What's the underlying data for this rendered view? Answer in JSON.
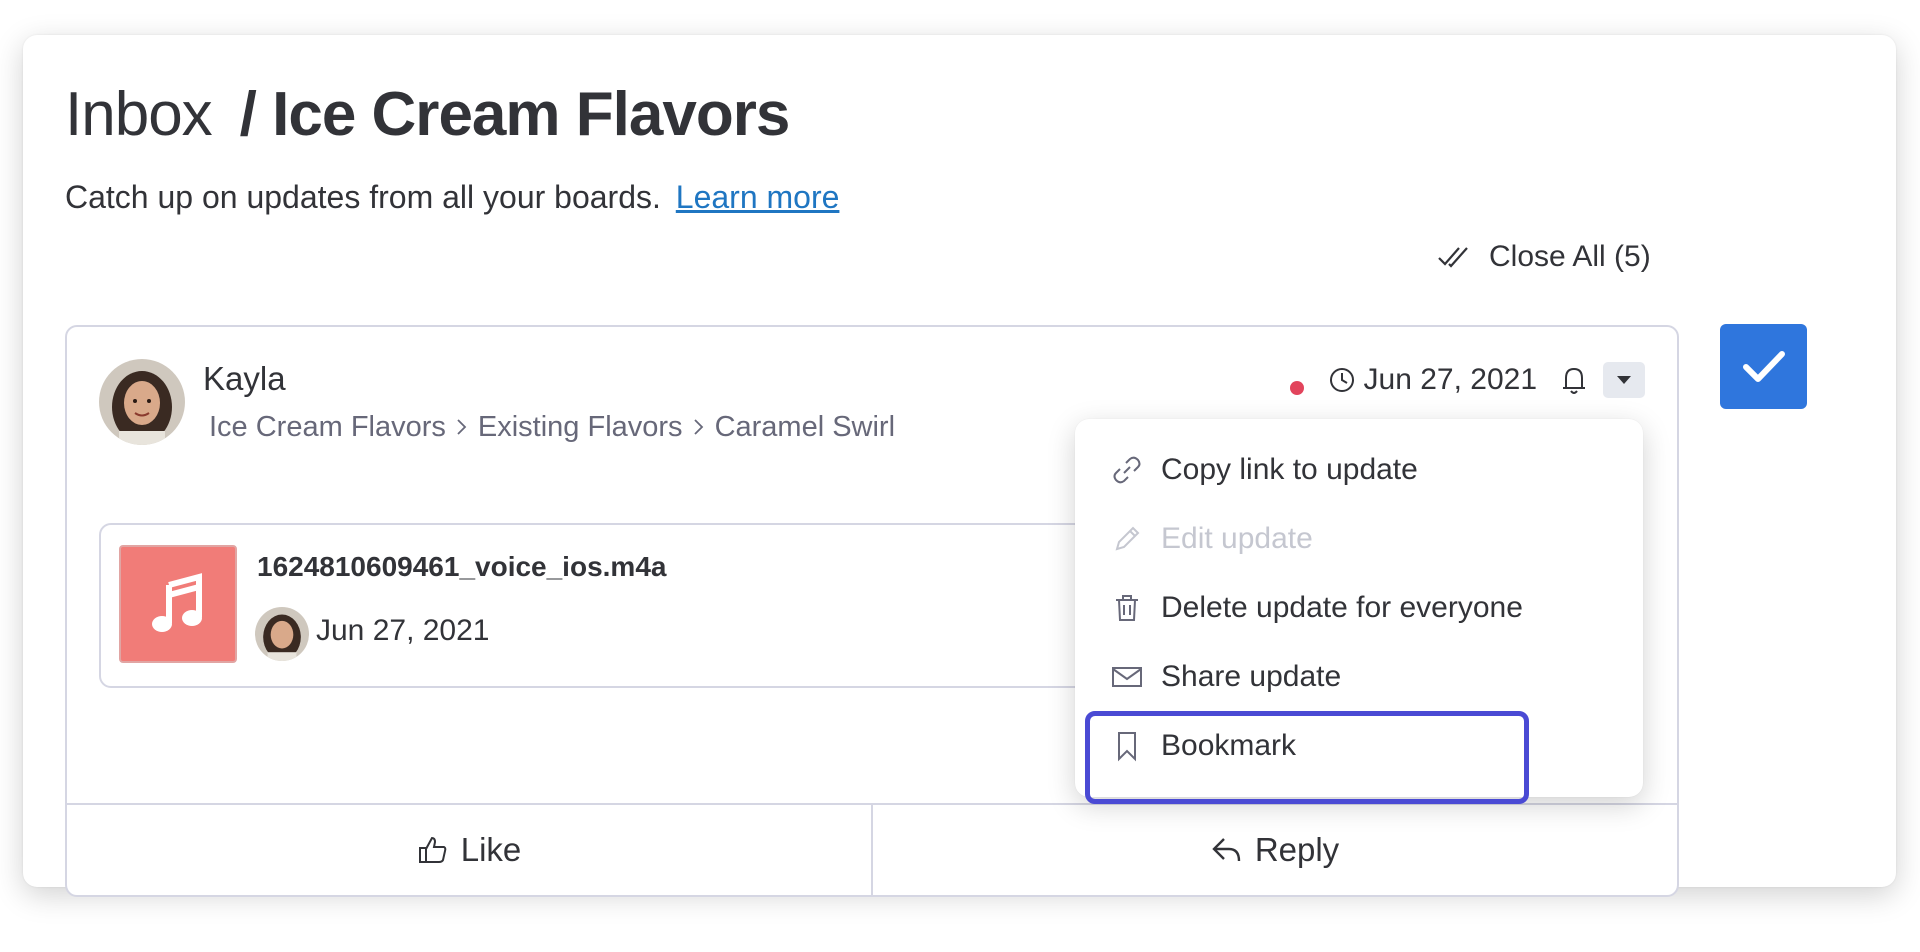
{
  "header": {
    "title_light": "Inbox",
    "title_bold": "/ Ice Cream Flavors",
    "subtitle": "Catch up on updates from all your boards.",
    "learn_more": "Learn more",
    "close_all": "Close All (5)"
  },
  "post": {
    "author": "Kayla",
    "breadcrumbs": [
      "Ice Cream Flavors",
      "Existing Flavors",
      "Caramel Swirl"
    ],
    "date": "Jun 27, 2021",
    "unread_dot_color": "#e2445c"
  },
  "attachment": {
    "file_name": "1624810609461_voice_ios.m4a",
    "date": "Jun 27, 2021",
    "icon": "music-note-icon",
    "thumb_color": "#f17c78"
  },
  "footer": {
    "like_label": "Like",
    "reply_label": "Reply"
  },
  "menu": {
    "items": [
      {
        "label": "Copy link to update",
        "icon": "link-icon"
      },
      {
        "label": "Edit update",
        "icon": "pencil-icon",
        "disabled": true
      },
      {
        "label": "Delete update for everyone",
        "icon": "trash-icon"
      },
      {
        "label": "Share update",
        "icon": "envelope-icon"
      },
      {
        "label": "Bookmark",
        "icon": "bookmark-icon",
        "highlighted": true
      }
    ]
  },
  "colors": {
    "accent": "#2f76dd",
    "link": "#1f76c2",
    "highlight_border": "#4a4ad4"
  }
}
